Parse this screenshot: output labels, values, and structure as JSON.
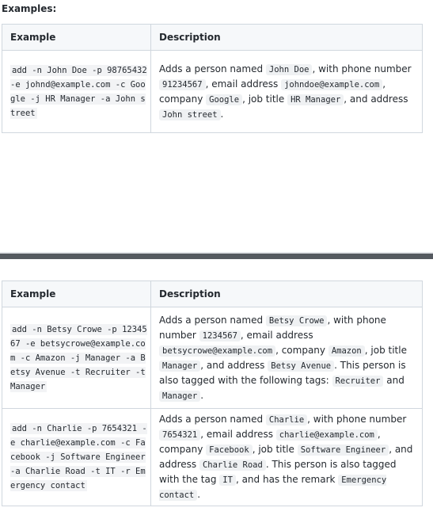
{
  "heading": "Examples:",
  "table_top": {
    "headers": [
      "Example",
      "Description"
    ],
    "rows": [
      {
        "example": "add -n John Doe -p 98765432 -e johnd@example.com -c Google -j HR Manager -a John street",
        "desc": [
          "Adds a person named ",
          {
            "code": "John Doe"
          },
          ", with phone number ",
          {
            "code": "91234567"
          },
          ", email address ",
          {
            "code": "johndoe@example.com"
          },
          ", company ",
          {
            "code": "Google"
          },
          ", job title ",
          {
            "code": "HR Manager"
          },
          ", and address ",
          {
            "code": "John street"
          },
          "."
        ]
      }
    ]
  },
  "table_bottom": {
    "headers": [
      "Example",
      "Description"
    ],
    "rows": [
      {
        "example": "add -n Betsy Crowe -p 1234567 -e betsycrowe@example.com -c Amazon -j Manager -a Betsy Avenue -t Recruiter -t Manager",
        "desc": [
          "Adds a person named ",
          {
            "code": "Betsy Crowe"
          },
          ", with phone number ",
          {
            "code": "1234567"
          },
          ", email address ",
          {
            "code": "betsycrowe@example.com"
          },
          ", company ",
          {
            "code": "Amazon"
          },
          ", job title ",
          {
            "code": "Manager"
          },
          ", and address ",
          {
            "code": "Betsy Avenue"
          },
          ". This person is also tagged with the following tags: ",
          {
            "code": "Recruiter"
          },
          " and ",
          {
            "code": "Manager"
          },
          "."
        ]
      },
      {
        "example": "add -n Charlie -p 7654321 -e charlie@example.com -c Facebook -j Software Engineer -a Charlie Road -t IT -r Emergency contact",
        "desc": [
          "Adds a person named ",
          {
            "code": "Charlie"
          },
          ", with phone number ",
          {
            "code": "7654321"
          },
          ", email address ",
          {
            "code": "charlie@example.com"
          },
          ", company ",
          {
            "code": "Facebook"
          },
          ", job title ",
          {
            "code": "Software Engineer"
          },
          ", and address ",
          {
            "code": "Charlie Road"
          },
          ". This person is also tagged with the tag ",
          {
            "code": "IT"
          },
          ", and has the remark ",
          {
            "code": "Emergency contact"
          },
          "."
        ]
      }
    ]
  }
}
